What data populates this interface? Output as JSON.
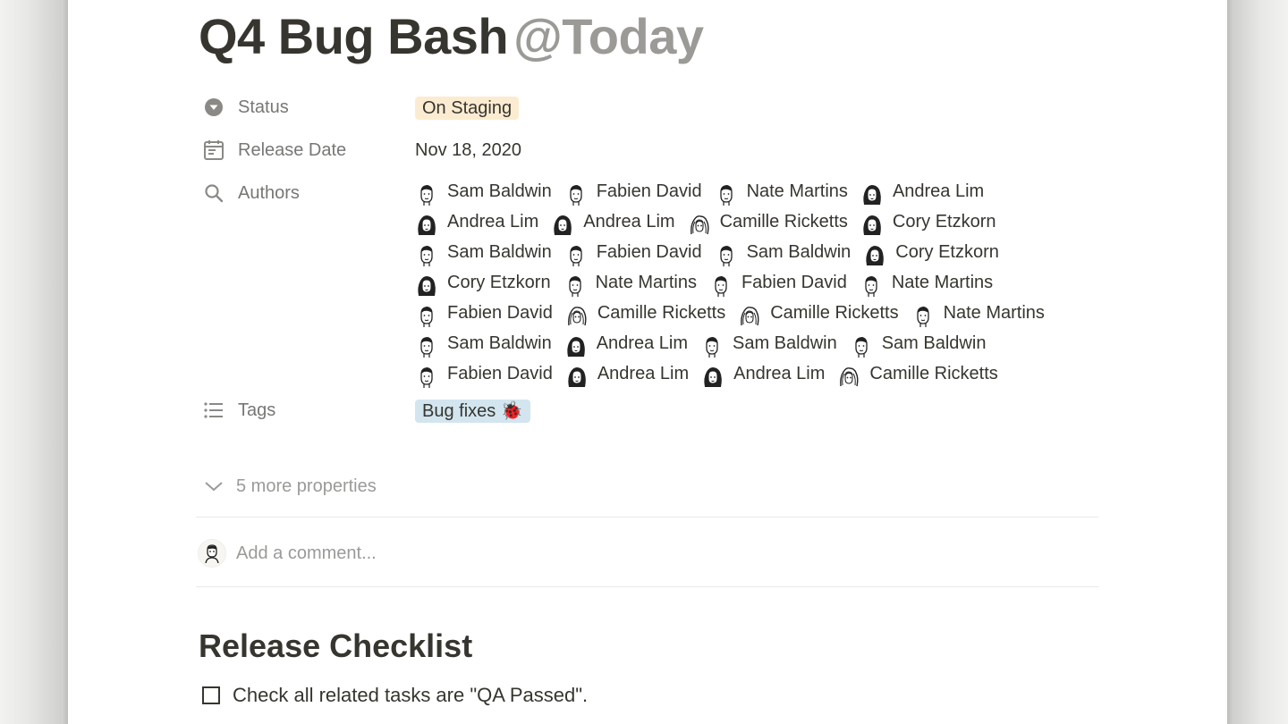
{
  "page": {
    "title": "Q4 Bug Bash",
    "title_mention": "@Today"
  },
  "properties": {
    "status": {
      "label": "Status",
      "value": "On Staging",
      "icon": "status-icon"
    },
    "release_date": {
      "label": "Release Date",
      "value": "Nov 18, 2020",
      "icon": "calendar-icon"
    },
    "authors": {
      "label": "Authors",
      "icon": "search-icon",
      "rows": [
        [
          {
            "name": "Sam Baldwin",
            "g": "m"
          },
          {
            "name": "Fabien David",
            "g": "m"
          },
          {
            "name": "Nate Martins",
            "g": "m"
          },
          {
            "name": "Andrea Lim",
            "g": "f"
          }
        ],
        [
          {
            "name": "Andrea Lim",
            "g": "f"
          },
          {
            "name": "Andrea Lim",
            "g": "f"
          },
          {
            "name": "Camille Ricketts",
            "g": "c"
          },
          {
            "name": "Cory Etzkorn",
            "g": "f"
          }
        ],
        [
          {
            "name": "Sam Baldwin",
            "g": "m"
          },
          {
            "name": "Fabien David",
            "g": "m"
          },
          {
            "name": "Sam Baldwin",
            "g": "m"
          },
          {
            "name": "Cory Etzkorn",
            "g": "f"
          }
        ],
        [
          {
            "name": "Cory Etzkorn",
            "g": "f"
          },
          {
            "name": "Nate Martins",
            "g": "m"
          },
          {
            "name": "Fabien David",
            "g": "m"
          },
          {
            "name": "Nate Martins",
            "g": "m"
          }
        ],
        [
          {
            "name": "Fabien David",
            "g": "m"
          },
          {
            "name": "Camille Ricketts",
            "g": "c"
          },
          {
            "name": "Camille Ricketts",
            "g": "c"
          },
          {
            "name": "Nate Martins",
            "g": "m"
          }
        ],
        [
          {
            "name": "Sam Baldwin",
            "g": "m"
          },
          {
            "name": "Andrea Lim",
            "g": "f"
          },
          {
            "name": "Sam Baldwin",
            "g": "m"
          },
          {
            "name": "Sam Baldwin",
            "g": "m"
          }
        ],
        [
          {
            "name": "Fabien David",
            "g": "m"
          },
          {
            "name": "Andrea Lim",
            "g": "f"
          },
          {
            "name": "Andrea Lim",
            "g": "f"
          },
          {
            "name": "Camille Ricketts",
            "g": "c"
          }
        ]
      ]
    },
    "tags": {
      "label": "Tags",
      "value": "Bug fixes 🐞",
      "icon": "list-icon"
    },
    "more": {
      "label": "5 more properties",
      "icon": "chevron-down-icon"
    }
  },
  "comment": {
    "placeholder": "Add a comment..."
  },
  "section": {
    "heading": "Release Checklist"
  },
  "checklist": [
    {
      "text": "Check all related tasks are \"QA Passed\".",
      "checked": false
    }
  ],
  "colors": {
    "text": "#37352f",
    "muted": "#787774",
    "placeholder": "#9b9a97",
    "status_pill_bg": "#fbecd1",
    "tag_pill_bg": "#d3e5ef"
  }
}
